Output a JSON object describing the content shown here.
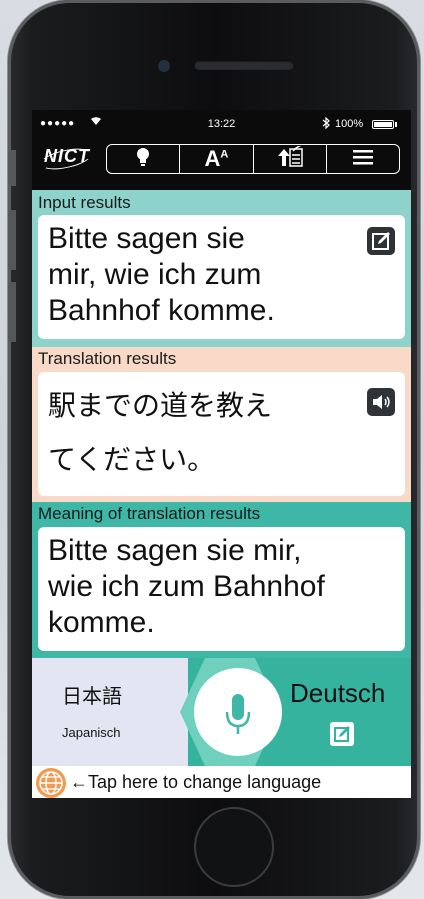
{
  "status_bar": {
    "signal": "●●●●● ",
    "time": "13:22",
    "battery": "100%"
  },
  "toolbar": {
    "logo": "NICT",
    "buttons": [
      "hint-bulb-icon",
      "font-size-icon",
      "upload-checklist-icon",
      "menu-icon"
    ],
    "font_size_label": "A",
    "font_size_sup": "A"
  },
  "sections": {
    "input": {
      "label": "Input results",
      "text": "Bitte sagen sie mir, wie ich zum Bahnhof komme.",
      "line1": "Bitte sagen sie",
      "line2": "mir, wie ich zum",
      "line3": "Bahnhof komme."
    },
    "translation": {
      "label": "Translation results",
      "line1": "駅までの道を教え",
      "line2": "てください。"
    },
    "meaning": {
      "label": "Meaning of translation results",
      "line1": "Bitte sagen sie mir,",
      "line2": "wie ich zum Bahnhof",
      "line3": "komme."
    }
  },
  "language_bar": {
    "source_language": "日本語",
    "source_language_sub": "Japanisch",
    "target_language": "Deutsch"
  },
  "hint": {
    "text": "←Tap here to change language"
  },
  "colors": {
    "input_bg": "#8ed2cc",
    "translation_bg": "#f9d9c7",
    "meaning_bg": "#3fb7a6",
    "accent": "#35b39e",
    "globe": "#f29a52"
  }
}
